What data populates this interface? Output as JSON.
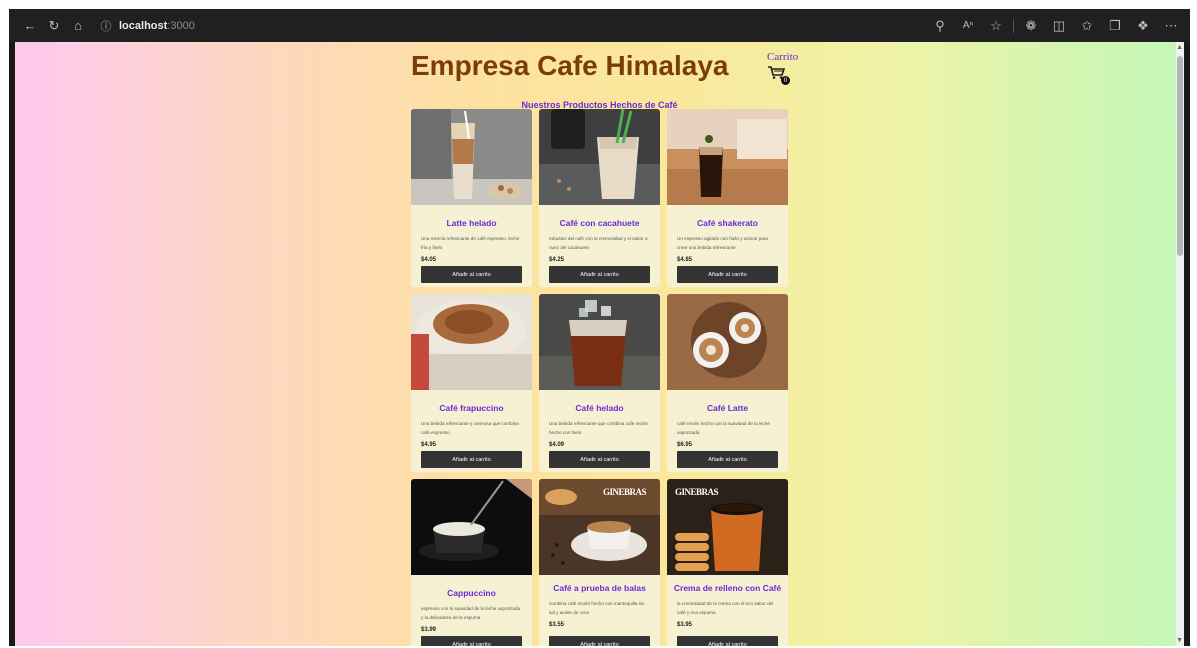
{
  "browser": {
    "url_host": "localhost",
    "url_port": ":3000"
  },
  "page": {
    "title": "Empresa Cafe Himalaya",
    "cart_label": "Carrito",
    "cart_count": "0",
    "subtitle": "Nuestros Productos Hechos de Café"
  },
  "products": [
    {
      "name": "Latte helado",
      "desc": "Una mezcla refrescante de café espresso, leche fría y hielo",
      "price": "$4.05",
      "button": "Añadir al carrito"
    },
    {
      "name": "Café con cacahuete",
      "desc": "robustez del café con la cremosidad y el sabor a nuez del cacahuete,",
      "price": "$4.25",
      "button": "Añadir al carrito"
    },
    {
      "name": "Café shakerato",
      "desc": "Un espresso agitado con hielo y azúcar para crear una bebida refrescante",
      "price": "$4.85",
      "button": "Añadir al carrito"
    },
    {
      "name": "Café frapuccino",
      "desc": "Una bebida refrescante y cremosa que combina café espresso",
      "price": "$4.95",
      "button": "Añadir al carrito"
    },
    {
      "name": "Café helado",
      "desc": "Una bebida refrescante que combina café recién hecho con hielo",
      "price": "$4.09",
      "button": "Añadir al carrito"
    },
    {
      "name": "Café Latte",
      "desc": "café recién hecho con la suavidad de la leche vaporizada",
      "price": "$6.95",
      "button": "Añadir al carrito"
    },
    {
      "name": "Cappuccino",
      "desc": "espresso con la suavidad de la leche vaporizada y la delicadeza de la espuma",
      "price": "$3.99",
      "button": "Añadir al carrito"
    },
    {
      "name": "Café a prueba de balas",
      "desc": "combina café recién hecho con mantequilla sin sal y aceite de coco",
      "price": "$3.55",
      "button": "Añadir al carrito"
    },
    {
      "name": "Crema de relleno con Café",
      "desc": "la cremosidad de la crema con el rico sabor del café y rica espuma",
      "price": "$3.95",
      "button": "Añadir al carrito"
    }
  ],
  "image_text": {
    "brand": "GINEBRAS"
  },
  "colors": {
    "title": "#7a3d06",
    "accent": "#6a2bd6",
    "card_bg": "#f6f1d2",
    "button_bg": "#333333"
  }
}
